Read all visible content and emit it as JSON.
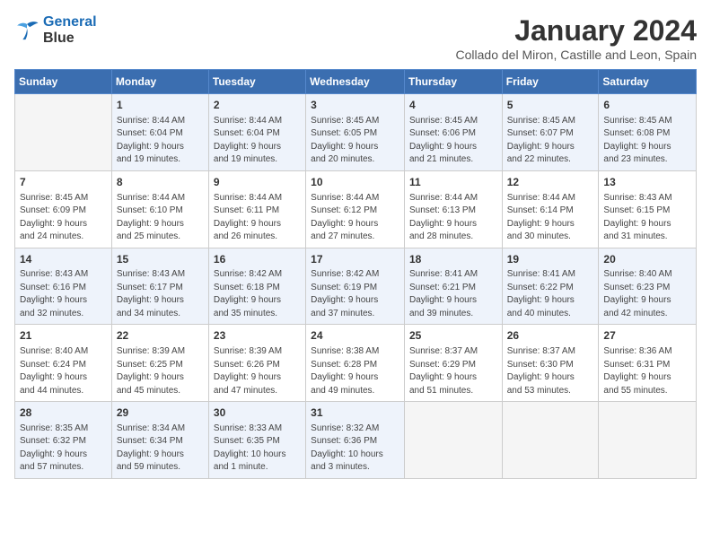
{
  "logo": {
    "line1": "General",
    "line2": "Blue"
  },
  "title": "January 2024",
  "subtitle": "Collado del Miron, Castille and Leon, Spain",
  "headers": [
    "Sunday",
    "Monday",
    "Tuesday",
    "Wednesday",
    "Thursday",
    "Friday",
    "Saturday"
  ],
  "weeks": [
    [
      {
        "day": "",
        "info": ""
      },
      {
        "day": "1",
        "info": "Sunrise: 8:44 AM\nSunset: 6:04 PM\nDaylight: 9 hours\nand 19 minutes."
      },
      {
        "day": "2",
        "info": "Sunrise: 8:44 AM\nSunset: 6:04 PM\nDaylight: 9 hours\nand 19 minutes."
      },
      {
        "day": "3",
        "info": "Sunrise: 8:45 AM\nSunset: 6:05 PM\nDaylight: 9 hours\nand 20 minutes."
      },
      {
        "day": "4",
        "info": "Sunrise: 8:45 AM\nSunset: 6:06 PM\nDaylight: 9 hours\nand 21 minutes."
      },
      {
        "day": "5",
        "info": "Sunrise: 8:45 AM\nSunset: 6:07 PM\nDaylight: 9 hours\nand 22 minutes."
      },
      {
        "day": "6",
        "info": "Sunrise: 8:45 AM\nSunset: 6:08 PM\nDaylight: 9 hours\nand 23 minutes."
      }
    ],
    [
      {
        "day": "7",
        "info": "Sunrise: 8:45 AM\nSunset: 6:09 PM\nDaylight: 9 hours\nand 24 minutes."
      },
      {
        "day": "8",
        "info": "Sunrise: 8:44 AM\nSunset: 6:10 PM\nDaylight: 9 hours\nand 25 minutes."
      },
      {
        "day": "9",
        "info": "Sunrise: 8:44 AM\nSunset: 6:11 PM\nDaylight: 9 hours\nand 26 minutes."
      },
      {
        "day": "10",
        "info": "Sunrise: 8:44 AM\nSunset: 6:12 PM\nDaylight: 9 hours\nand 27 minutes."
      },
      {
        "day": "11",
        "info": "Sunrise: 8:44 AM\nSunset: 6:13 PM\nDaylight: 9 hours\nand 28 minutes."
      },
      {
        "day": "12",
        "info": "Sunrise: 8:44 AM\nSunset: 6:14 PM\nDaylight: 9 hours\nand 30 minutes."
      },
      {
        "day": "13",
        "info": "Sunrise: 8:43 AM\nSunset: 6:15 PM\nDaylight: 9 hours\nand 31 minutes."
      }
    ],
    [
      {
        "day": "14",
        "info": "Sunrise: 8:43 AM\nSunset: 6:16 PM\nDaylight: 9 hours\nand 32 minutes."
      },
      {
        "day": "15",
        "info": "Sunrise: 8:43 AM\nSunset: 6:17 PM\nDaylight: 9 hours\nand 34 minutes."
      },
      {
        "day": "16",
        "info": "Sunrise: 8:42 AM\nSunset: 6:18 PM\nDaylight: 9 hours\nand 35 minutes."
      },
      {
        "day": "17",
        "info": "Sunrise: 8:42 AM\nSunset: 6:19 PM\nDaylight: 9 hours\nand 37 minutes."
      },
      {
        "day": "18",
        "info": "Sunrise: 8:41 AM\nSunset: 6:21 PM\nDaylight: 9 hours\nand 39 minutes."
      },
      {
        "day": "19",
        "info": "Sunrise: 8:41 AM\nSunset: 6:22 PM\nDaylight: 9 hours\nand 40 minutes."
      },
      {
        "day": "20",
        "info": "Sunrise: 8:40 AM\nSunset: 6:23 PM\nDaylight: 9 hours\nand 42 minutes."
      }
    ],
    [
      {
        "day": "21",
        "info": "Sunrise: 8:40 AM\nSunset: 6:24 PM\nDaylight: 9 hours\nand 44 minutes."
      },
      {
        "day": "22",
        "info": "Sunrise: 8:39 AM\nSunset: 6:25 PM\nDaylight: 9 hours\nand 45 minutes."
      },
      {
        "day": "23",
        "info": "Sunrise: 8:39 AM\nSunset: 6:26 PM\nDaylight: 9 hours\nand 47 minutes."
      },
      {
        "day": "24",
        "info": "Sunrise: 8:38 AM\nSunset: 6:28 PM\nDaylight: 9 hours\nand 49 minutes."
      },
      {
        "day": "25",
        "info": "Sunrise: 8:37 AM\nSunset: 6:29 PM\nDaylight: 9 hours\nand 51 minutes."
      },
      {
        "day": "26",
        "info": "Sunrise: 8:37 AM\nSunset: 6:30 PM\nDaylight: 9 hours\nand 53 minutes."
      },
      {
        "day": "27",
        "info": "Sunrise: 8:36 AM\nSunset: 6:31 PM\nDaylight: 9 hours\nand 55 minutes."
      }
    ],
    [
      {
        "day": "28",
        "info": "Sunrise: 8:35 AM\nSunset: 6:32 PM\nDaylight: 9 hours\nand 57 minutes."
      },
      {
        "day": "29",
        "info": "Sunrise: 8:34 AM\nSunset: 6:34 PM\nDaylight: 9 hours\nand 59 minutes."
      },
      {
        "day": "30",
        "info": "Sunrise: 8:33 AM\nSunset: 6:35 PM\nDaylight: 10 hours\nand 1 minute."
      },
      {
        "day": "31",
        "info": "Sunrise: 8:32 AM\nSunset: 6:36 PM\nDaylight: 10 hours\nand 3 minutes."
      },
      {
        "day": "",
        "info": ""
      },
      {
        "day": "",
        "info": ""
      },
      {
        "day": "",
        "info": ""
      }
    ]
  ]
}
